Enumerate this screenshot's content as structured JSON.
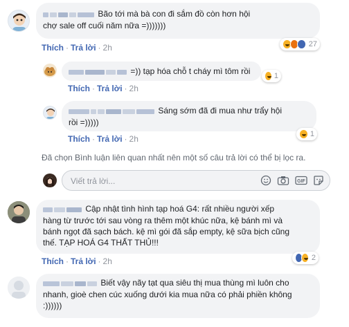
{
  "comments": [
    {
      "text_line1": "Bão tới mà bà con đi sắm đồ còn hơn hội",
      "text_line2": "chợ sale off cuối năm nữa =)))))))",
      "like": "Thích",
      "reply": "Trả lời",
      "time": "2h",
      "reaction_count": "27"
    },
    {
      "text": "=)) tạp hóa chỗ t cháy mì tôm rồi",
      "like": "Thích",
      "reply": "Trả lời",
      "time": "2h",
      "reaction_count": "1"
    },
    {
      "text_line1": "Sáng sớm đã đi mua như trẩy hội",
      "text_line2": "rồi =)))))",
      "like": "Thích",
      "reply": "Trả lời",
      "time": "2h",
      "reaction_count": "1"
    },
    {
      "text_line1": "Cập nhật tình hình tạp hoá G4: rất nhiều người xếp",
      "text_line2": "hàng từ trước tới sau vòng ra thêm một khúc nữa, kệ bánh mì và",
      "text_line3": "bánh ngọt đã sạch bách. kệ mì gói đã sắp empty, kệ sữa bịch cũng",
      "text_line4": "thế. TẠP HOÁ G4 THẤT THỦ!!!",
      "like": "Thích",
      "reply": "Trả lời",
      "time": "2h",
      "reaction_count": "2"
    },
    {
      "text_line1": "Biết vậy nãy tạt qua siêu thị mua thùng mì luôn cho",
      "text_line2": "nhanh, gioè chen cúc xuống dưới kia mua nữa có phải phiền không",
      "text_line3": ":))))))"
    }
  ],
  "notice": "Đã chọn Bình luận liên quan nhất nên một số câu trả lời có thể bị lọc ra.",
  "reply_input": {
    "placeholder": "Viết trả lời..."
  },
  "icons": [
    "emoji-icon",
    "camera-icon",
    "gif-icon",
    "sticker-icon"
  ],
  "colors": {
    "link": "#4267b2",
    "muted": "#90949c",
    "bubble": "#f2f3f5"
  }
}
